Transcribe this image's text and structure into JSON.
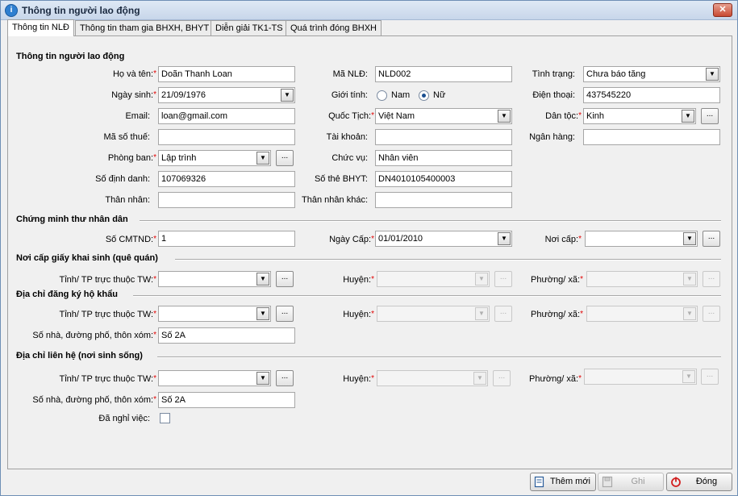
{
  "window": {
    "title": "Thông tin người lao động",
    "close_label": "✕"
  },
  "tabs": [
    {
      "label": "Thông tin NLĐ",
      "active": true
    },
    {
      "label": "Thông tin tham gia BHXH, BHYT",
      "active": false
    },
    {
      "label": "Diễn giải TK1-TS",
      "active": false
    },
    {
      "label": "Quá trình đóng BHXH",
      "active": false
    }
  ],
  "required_mark": "*",
  "sections": {
    "worker": {
      "title": "Thông tin người lao động",
      "ho_va_ten": {
        "label": "Họ và tên:",
        "value": "Doãn Thanh Loan"
      },
      "ngay_sinh": {
        "label": "Ngày sinh:",
        "value": "21/09/1976"
      },
      "email": {
        "label": "Email:",
        "value": "loan@gmail.com"
      },
      "ma_so_thue": {
        "label": "Mã số thuế:",
        "value": ""
      },
      "phong_ban": {
        "label": "Phòng ban:",
        "value": "Lập trình"
      },
      "so_dinh_danh": {
        "label": "Số định danh:",
        "value": "107069326"
      },
      "than_nhan": {
        "label": "Thân nhân:",
        "value": ""
      },
      "ma_nld": {
        "label": "Mã NLĐ:",
        "value": "NLD002"
      },
      "gioi_tinh": {
        "label": "Giới tính:",
        "options": [
          "Nam",
          "Nữ"
        ],
        "selected": "Nữ"
      },
      "quoc_tich": {
        "label": "Quốc Tịch:",
        "value": "Việt Nam"
      },
      "tai_khoan": {
        "label": "Tài khoản:",
        "value": ""
      },
      "chuc_vu": {
        "label": "Chức vụ:",
        "value": "Nhân viên"
      },
      "so_the_bhyt": {
        "label": "Số thẻ BHYT:",
        "value": "DN4010105400003"
      },
      "than_nhan_khac": {
        "label": "Thân nhân khác:",
        "value": ""
      },
      "tinh_trang": {
        "label": "Tình trạng:",
        "value": "Chưa báo tăng"
      },
      "dien_thoai": {
        "label": "Điện thoại:",
        "value": "437545220"
      },
      "dan_toc": {
        "label": "Dân tộc:",
        "value": "Kinh"
      },
      "ngan_hang": {
        "label": "Ngân hàng:",
        "value": ""
      }
    },
    "id_card": {
      "title": "Chứng minh thư nhân dân",
      "so_cmtnd": {
        "label": "Số CMTND:",
        "value": "1"
      },
      "ngay_cap": {
        "label": "Ngày Cấp:",
        "value": "01/01/2010"
      },
      "noi_cap": {
        "label": "Nơi cấp:",
        "value": ""
      }
    },
    "birth_place": {
      "title": "Nơi cấp giấy khai sinh (quê quán)",
      "tinh": {
        "label": "Tỉnh/ TP trực thuộc TW:",
        "value": ""
      },
      "huyen": {
        "label": "Huyện:",
        "value": ""
      },
      "phuong": {
        "label": "Phường/ xã:",
        "value": ""
      }
    },
    "household": {
      "title": "Địa chỉ đăng ký hộ khẩu",
      "tinh": {
        "label": "Tỉnh/ TP trực thuộc TW:",
        "value": ""
      },
      "huyen": {
        "label": "Huyện:",
        "value": ""
      },
      "phuong": {
        "label": "Phường/ xã:",
        "value": ""
      },
      "so_nha": {
        "label": "Số nhà, đường phố, thôn xóm:",
        "value": "Số 2A"
      }
    },
    "contact": {
      "title": "Địa chỉ liên hệ (nơi sinh sống)",
      "tinh": {
        "label": "Tỉnh/ TP trực thuộc TW:",
        "value": ""
      },
      "huyen": {
        "label": "Huyện:",
        "value": ""
      },
      "phuong": {
        "label": "Phường/ xã:",
        "value": ""
      },
      "so_nha": {
        "label": "Số nhà, đường phố, thôn xóm:",
        "value": "Số 2A"
      },
      "da_nghi_viec": {
        "label": "Đã nghỉ việc:",
        "checked": false
      }
    }
  },
  "buttons": {
    "them_moi": "Thêm mới",
    "ghi": "Ghi",
    "dong": "Đóng"
  },
  "ui": {
    "arrow_glyph": "▼",
    "dots_glyph": "..."
  },
  "colors": {
    "required": "#e00000",
    "accent": "#2f7fd0",
    "close": "#c84a33"
  }
}
